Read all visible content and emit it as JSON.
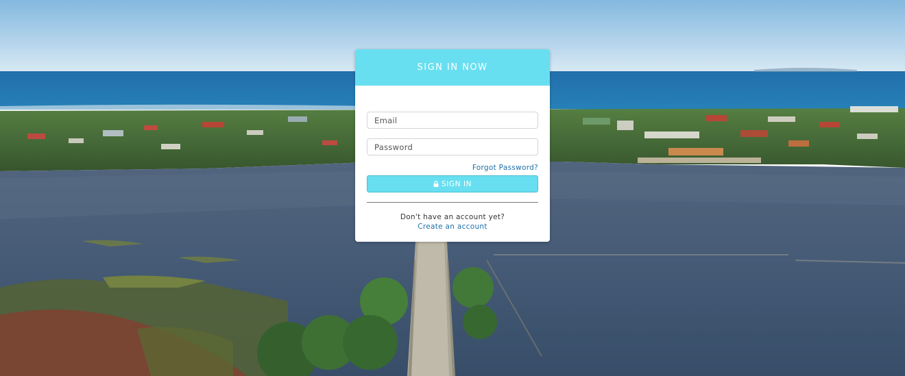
{
  "login": {
    "title": "SIGN IN NOW",
    "email_placeholder": "Email",
    "password_placeholder": "Password",
    "forgot_password": "Forgot Password?",
    "signin_label": "SIGN IN",
    "no_account": "Don't have an account yet?",
    "create_account": "Create an account"
  },
  "icons": {
    "signin": "lock-icon"
  },
  "colors": {
    "accent": "#68dff0",
    "link": "#1c6fa8",
    "card_bg": "#ffffff"
  }
}
